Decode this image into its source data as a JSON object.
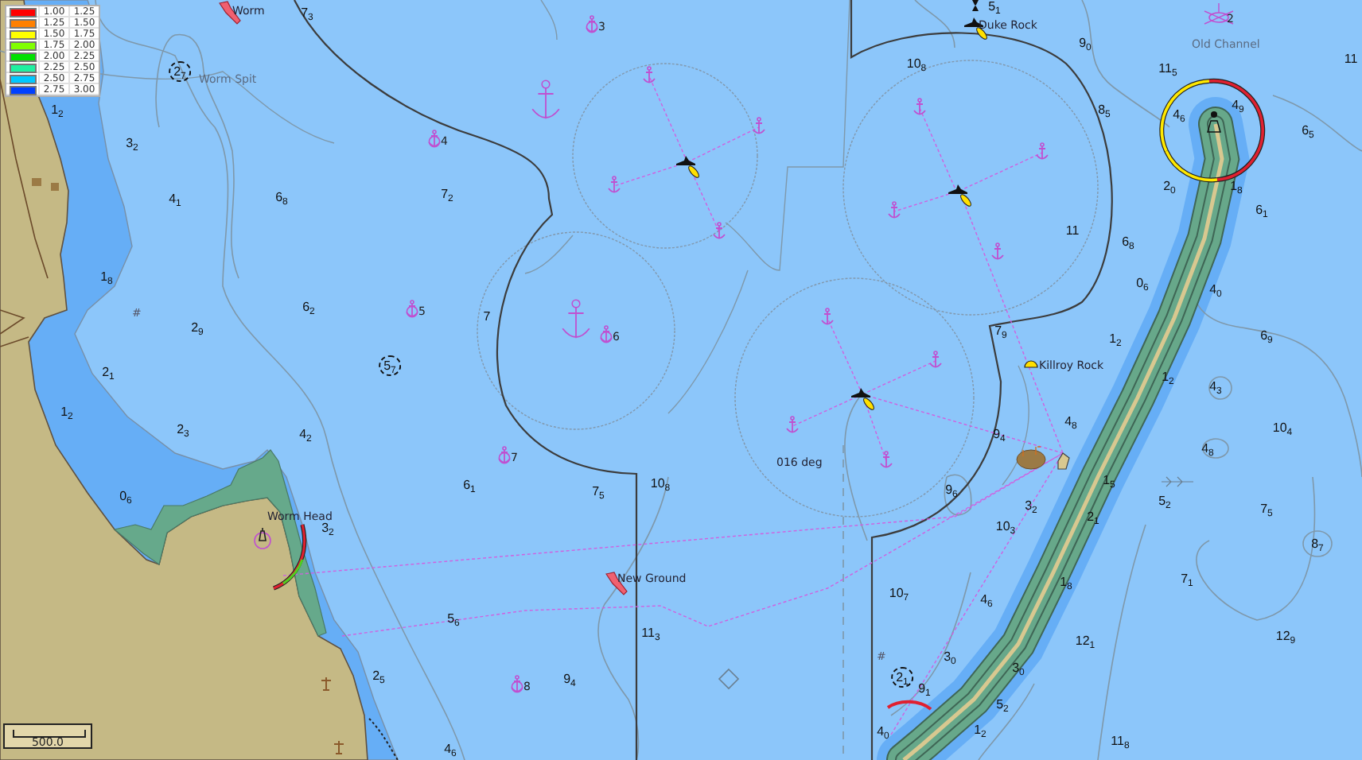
{
  "legend": [
    {
      "color": "#ff0000",
      "from": "1.00",
      "to": "1.25"
    },
    {
      "color": "#ff8000",
      "from": "1.25",
      "to": "1.50"
    },
    {
      "color": "#ffff00",
      "from": "1.50",
      "to": "1.75"
    },
    {
      "color": "#80ff00",
      "from": "1.75",
      "to": "2.00"
    },
    {
      "color": "#00e000",
      "from": "2.00",
      "to": "2.25"
    },
    {
      "color": "#20f0a0",
      "from": "2.25",
      "to": "2.50"
    },
    {
      "color": "#00c8ff",
      "from": "2.50",
      "to": "2.75"
    },
    {
      "color": "#0040ff",
      "from": "2.75",
      "to": "3.00"
    }
  ],
  "place_labels": [
    "Worm",
    "Worm Spit",
    "Duke Rock",
    "Old Channel",
    "Killroy Rock",
    "Worm Head",
    "New Ground"
  ],
  "bearing_label": "016 deg",
  "soundings": [
    "7$_{3}$",
    "1$_{2}$",
    "3$_{2}$",
    "4$_{1}$",
    "6$_{8}$",
    "7$_{2}$",
    "1$_{8}$",
    "2$_{9}$",
    "6$_{2}$",
    "7",
    "2$_{1}$",
    "1$_{2}$",
    "2$_{3}$",
    "4$_{2}$",
    "0$_{6}$",
    "6$_{1}$",
    "7$_{5}$",
    "10$_{8}$",
    "3$_{2}$",
    "5$_{6}$",
    "11$_{3}$",
    "2$_{5}$",
    "9$_{4}$",
    "4$_{6}$",
    "5$_{1}$",
    "10$_{8}$",
    "9$_{0}$",
    "11$_{5}$",
    "11",
    "8$_{5}$",
    "4$_{6}$",
    "4$_{9}$",
    "6$_{5}$",
    "2$_{0}$",
    "1$_{8}$",
    "6$_{1}$",
    "11",
    "6$_{8}$",
    "0$_{6}$",
    "4$_{0}$",
    "7$_{9}$",
    "6$_{9}$",
    "1$_{2}$",
    "1$_{2}$",
    "4$_{3}$",
    "10$_{4}$",
    "9$_{4}$",
    "4$_{8}$",
    "4$_{8}$",
    "1$_{5}$",
    "9$_{6}$",
    "3$_{2}$",
    "5$_{2}$",
    "2$_{1}$",
    "7$_{5}$",
    "10$_{3}$",
    "8$_{7}$",
    "1$_{8}$",
    "7$_{1}$",
    "10$_{7}$",
    "4$_{6}$",
    "12$_{1}$",
    "12$_{9}$",
    "3$_{0}$",
    "3$_{0}$",
    "9$_{1}$",
    "5$_{2}$",
    "4$_{0}$",
    "1$_{2}$",
    "11$_{8}$"
  ],
  "circled_soundings": [
    "2$_{7}$",
    "5$_{7}$",
    "2$_{1}$"
  ],
  "anchorage_numbers": [
    "3",
    "4",
    "5",
    "6",
    "7",
    "8"
  ],
  "old_channel_number": "2",
  "foul_ground_marks": [
    "#",
    "#"
  ],
  "scale_bar": {
    "label": "500.0"
  }
}
